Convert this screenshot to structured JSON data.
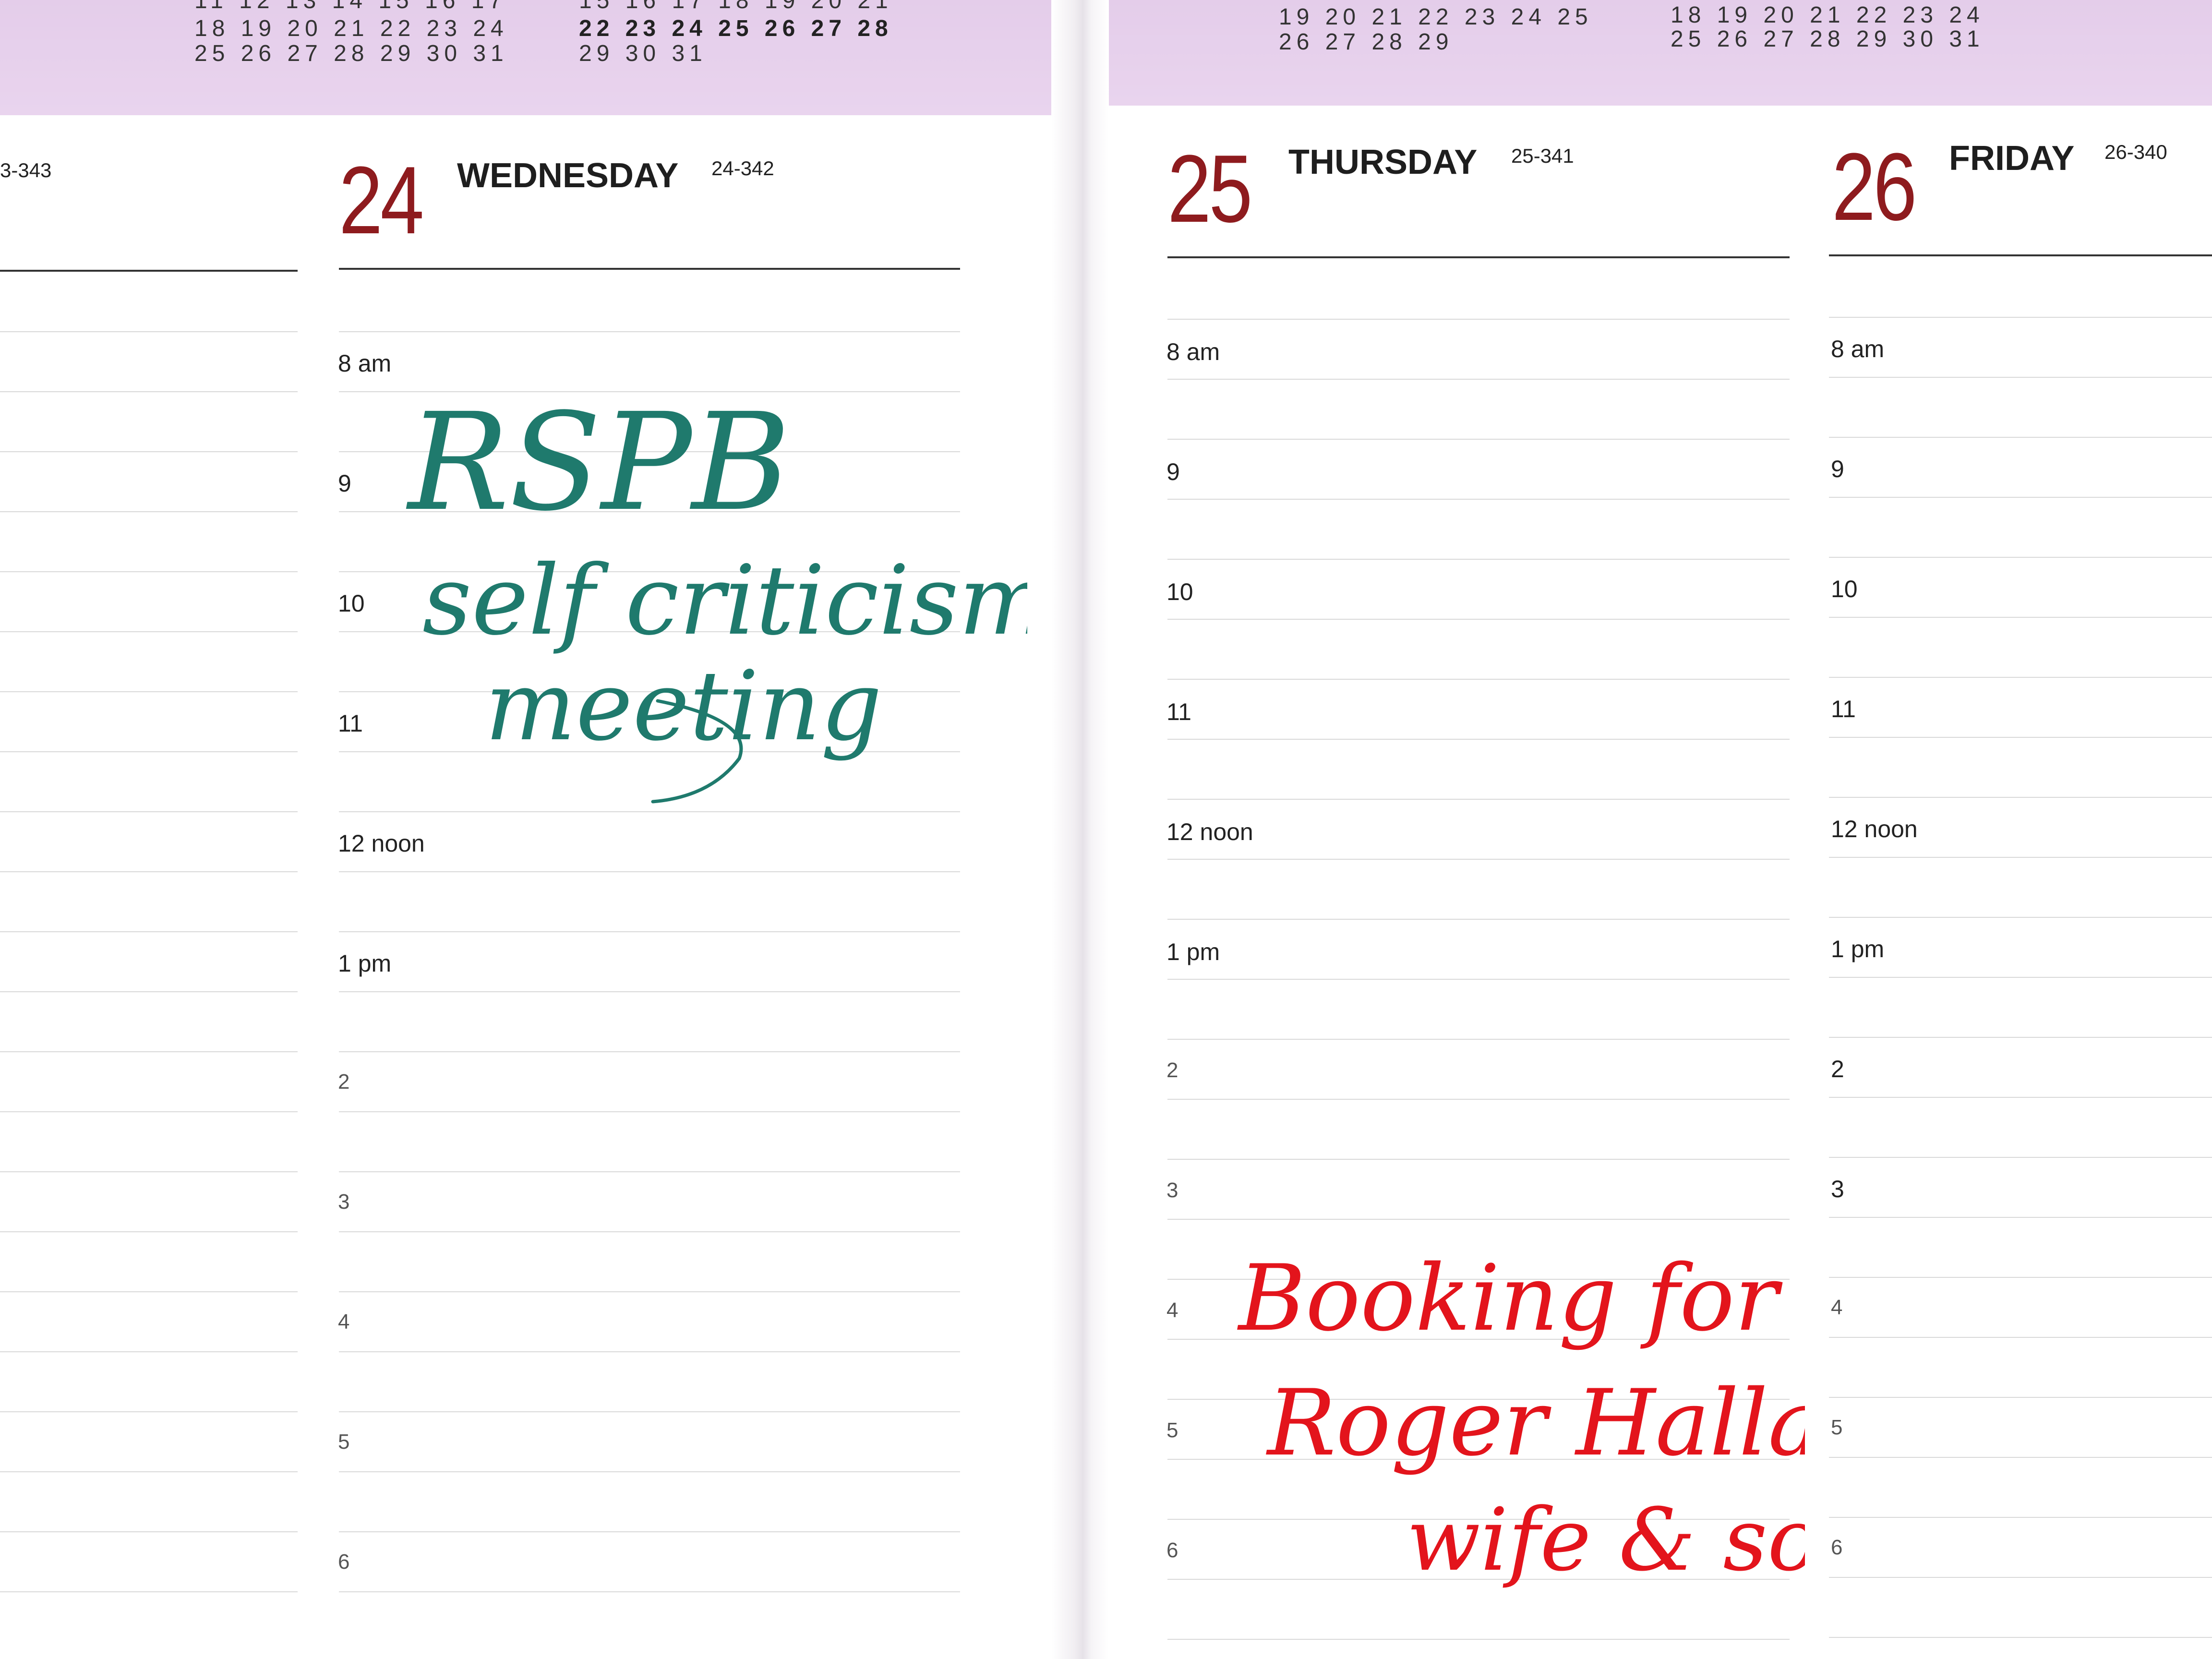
{
  "mini_calendars": {
    "left_a": {
      "rows": [
        "11 12 13 14 15 16 17",
        "18 19 20 21 22 23 24",
        "25 26 27 28 29 30 31"
      ]
    },
    "left_b": {
      "rows": [
        "15 16 17 18 19 20 21",
        "22 23 24 25 26 27 28",
        "29 30 31"
      ]
    },
    "right_a": {
      "rows": [
        "19 20 21 22 23 24 25",
        "26 27 28 29"
      ]
    },
    "right_b": {
      "rows": [
        "18 19 20 21 22 23 24",
        "25 26 27 28 29 30 31"
      ]
    }
  },
  "prev_day_code": "3-343",
  "days": [
    {
      "number": "24",
      "name": "WEDNESDAY",
      "code": "24-342"
    },
    {
      "number": "25",
      "name": "THURSDAY",
      "code": "25-341"
    },
    {
      "number": "26",
      "name": "FRIDAY",
      "code": "26-340"
    }
  ],
  "hours": [
    "8 am",
    "9",
    "10",
    "11",
    "12 noon",
    "1 pm",
    "2",
    "3",
    "4",
    "5",
    "6"
  ],
  "entries": {
    "wednesday": {
      "lines": [
        "RSPB",
        "self criticism",
        "meeting"
      ],
      "ink_color": "#1f7a6d"
    },
    "thursday": {
      "lines": [
        "Booking for",
        "Roger Hallam's",
        "wife & son"
      ],
      "ink_color": "#e3141c"
    }
  },
  "colors": {
    "date_number": "#8e1b1e",
    "header_band": "#e6d0ec"
  }
}
